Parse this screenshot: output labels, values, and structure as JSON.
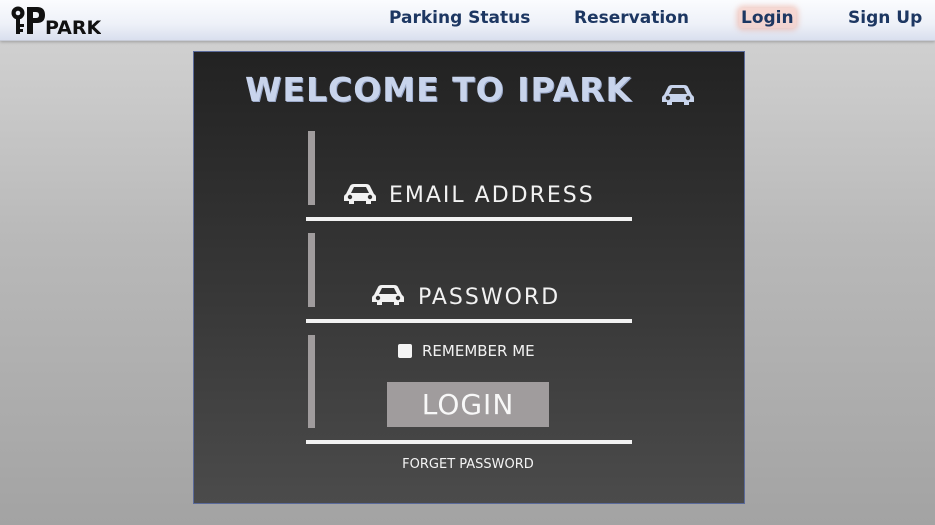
{
  "nav": {
    "logo_text": "PARK",
    "items": [
      {
        "label": "Parking Status"
      },
      {
        "label": "Reservation"
      },
      {
        "label": "Login",
        "active": true
      },
      {
        "label": "Sign Up"
      }
    ]
  },
  "login_panel": {
    "title": "WELCOME TO IPARK",
    "email_label": "EMAIL ADDRESS",
    "password_label": "PASSWORD",
    "remember_label": "REMEMBER ME",
    "remember_checked": false,
    "login_button": "LOGIN",
    "forget_link": "FORGET PASSWORD"
  },
  "icons": {
    "title_icon": "car-icon",
    "email_icon": "car-icon",
    "password_icon": "car-icon",
    "logo_icon": "key-icon"
  },
  "colors": {
    "nav_text": "#1d3762",
    "title_text": "#c8d4ec",
    "panel_bg": "#333333",
    "button_bg": "#a09c9d",
    "active_nav_highlight": "#f6beb0"
  }
}
